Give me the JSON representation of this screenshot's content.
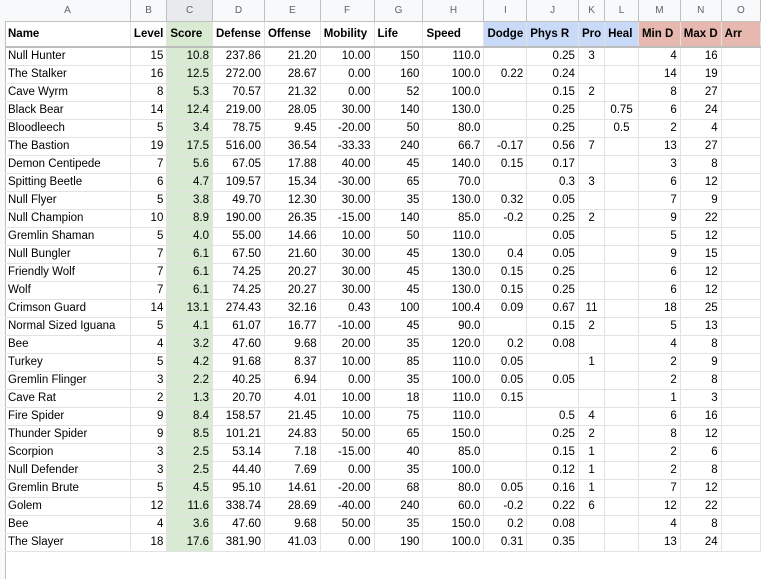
{
  "column_letters": [
    "A",
    "B",
    "C",
    "D",
    "E",
    "F",
    "G",
    "H",
    "I",
    "J",
    "K",
    "L",
    "M",
    "N",
    "O"
  ],
  "headers": [
    "Name",
    "Level",
    "Score",
    "Defense",
    "Offense",
    "Mobility",
    "Life",
    "Speed",
    "Dodge",
    "Phys R",
    "Pro",
    "Heal",
    "Min D",
    "Max D",
    "Arr"
  ],
  "rows": [
    [
      "Null Hunter",
      "15",
      "10.8",
      "237.86",
      "21.20",
      "10.00",
      "150",
      "110.0",
      "",
      "0.25",
      "3",
      "",
      "4",
      "16",
      ""
    ],
    [
      "The Stalker",
      "16",
      "12.5",
      "272.00",
      "28.67",
      "0.00",
      "160",
      "100.0",
      "0.22",
      "0.24",
      "",
      "",
      "14",
      "19",
      ""
    ],
    [
      "Cave Wyrm",
      "8",
      "5.3",
      "70.57",
      "21.32",
      "0.00",
      "52",
      "100.0",
      "",
      "0.15",
      "2",
      "",
      "8",
      "27",
      ""
    ],
    [
      "Black Bear",
      "14",
      "12.4",
      "219.00",
      "28.05",
      "30.00",
      "140",
      "130.0",
      "",
      "0.25",
      "",
      "0.75",
      "6",
      "24",
      ""
    ],
    [
      "Bloodleech",
      "5",
      "3.4",
      "78.75",
      "9.45",
      "-20.00",
      "50",
      "80.0",
      "",
      "0.25",
      "",
      "0.5",
      "2",
      "4",
      ""
    ],
    [
      "The Bastion",
      "19",
      "17.5",
      "516.00",
      "36.54",
      "-33.33",
      "240",
      "66.7",
      "-0.17",
      "0.56",
      "7",
      "",
      "13",
      "27",
      ""
    ],
    [
      "Demon Centipede",
      "7",
      "5.6",
      "67.05",
      "17.88",
      "40.00",
      "45",
      "140.0",
      "0.15",
      "0.17",
      "",
      "",
      "3",
      "8",
      ""
    ],
    [
      "Spitting Beetle",
      "6",
      "4.7",
      "109.57",
      "15.34",
      "-30.00",
      "65",
      "70.0",
      "",
      "0.3",
      "3",
      "",
      "6",
      "12",
      ""
    ],
    [
      "Null Flyer",
      "5",
      "3.8",
      "49.70",
      "12.30",
      "30.00",
      "35",
      "130.0",
      "0.32",
      "0.05",
      "",
      "",
      "7",
      "9",
      ""
    ],
    [
      "Null Champion",
      "10",
      "8.9",
      "190.00",
      "26.35",
      "-15.00",
      "140",
      "85.0",
      "-0.2",
      "0.25",
      "2",
      "",
      "9",
      "22",
      ""
    ],
    [
      "Gremlin Shaman",
      "5",
      "4.0",
      "55.00",
      "14.66",
      "10.00",
      "50",
      "110.0",
      "",
      "0.05",
      "",
      "",
      "5",
      "12",
      ""
    ],
    [
      "Null Bungler",
      "7",
      "6.1",
      "67.50",
      "21.60",
      "30.00",
      "45",
      "130.0",
      "0.4",
      "0.05",
      "",
      "",
      "9",
      "15",
      ""
    ],
    [
      "Friendly Wolf",
      "7",
      "6.1",
      "74.25",
      "20.27",
      "30.00",
      "45",
      "130.0",
      "0.15",
      "0.25",
      "",
      "",
      "6",
      "12",
      ""
    ],
    [
      "Wolf",
      "7",
      "6.1",
      "74.25",
      "20.27",
      "30.00",
      "45",
      "130.0",
      "0.15",
      "0.25",
      "",
      "",
      "6",
      "12",
      ""
    ],
    [
      "Crimson Guard",
      "14",
      "13.1",
      "274.43",
      "32.16",
      "0.43",
      "100",
      "100.4",
      "0.09",
      "0.67",
      "11",
      "",
      "18",
      "25",
      ""
    ],
    [
      "Normal Sized Iguana",
      "5",
      "4.1",
      "61.07",
      "16.77",
      "-10.00",
      "45",
      "90.0",
      "",
      "0.15",
      "2",
      "",
      "5",
      "13",
      ""
    ],
    [
      "Bee",
      "4",
      "3.2",
      "47.60",
      "9.68",
      "20.00",
      "35",
      "120.0",
      "0.2",
      "0.08",
      "",
      "",
      "4",
      "8",
      ""
    ],
    [
      "Turkey",
      "5",
      "4.2",
      "91.68",
      "8.37",
      "10.00",
      "85",
      "110.0",
      "0.05",
      "",
      "1",
      "",
      "2",
      "9",
      ""
    ],
    [
      "Gremlin Flinger",
      "3",
      "2.2",
      "40.25",
      "6.94",
      "0.00",
      "35",
      "100.0",
      "0.05",
      "0.05",
      "",
      "",
      "2",
      "8",
      ""
    ],
    [
      "Cave Rat",
      "2",
      "1.3",
      "20.70",
      "4.01",
      "10.00",
      "18",
      "110.0",
      "0.15",
      "",
      "",
      "",
      "1",
      "3",
      ""
    ],
    [
      "Fire Spider",
      "9",
      "8.4",
      "158.57",
      "21.45",
      "10.00",
      "75",
      "110.0",
      "",
      "0.5",
      "4",
      "",
      "6",
      "16",
      ""
    ],
    [
      "Thunder Spider",
      "9",
      "8.5",
      "101.21",
      "24.83",
      "50.00",
      "65",
      "150.0",
      "",
      "0.25",
      "2",
      "",
      "8",
      "12",
      ""
    ],
    [
      "Scorpion",
      "3",
      "2.5",
      "53.14",
      "7.18",
      "-15.00",
      "40",
      "85.0",
      "",
      "0.15",
      "1",
      "",
      "2",
      "6",
      ""
    ],
    [
      "Null Defender",
      "3",
      "2.5",
      "44.40",
      "7.69",
      "0.00",
      "35",
      "100.0",
      "",
      "0.12",
      "1",
      "",
      "2",
      "8",
      ""
    ],
    [
      "Gremlin Brute",
      "5",
      "4.5",
      "95.10",
      "14.61",
      "-20.00",
      "68",
      "80.0",
      "0.05",
      "0.16",
      "1",
      "",
      "7",
      "12",
      ""
    ],
    [
      "Golem",
      "12",
      "11.6",
      "338.74",
      "28.69",
      "-40.00",
      "240",
      "60.0",
      "-0.2",
      "0.22",
      "6",
      "",
      "12",
      "22",
      ""
    ],
    [
      "Bee",
      "4",
      "3.6",
      "47.60",
      "9.68",
      "50.00",
      "35",
      "150.0",
      "0.2",
      "0.08",
      "",
      "",
      "4",
      "8",
      ""
    ],
    [
      "The Slayer",
      "18",
      "17.6",
      "381.90",
      "41.03",
      "0.00",
      "190",
      "100.0",
      "0.31",
      "0.35",
      "",
      "",
      "13",
      "24",
      ""
    ]
  ]
}
